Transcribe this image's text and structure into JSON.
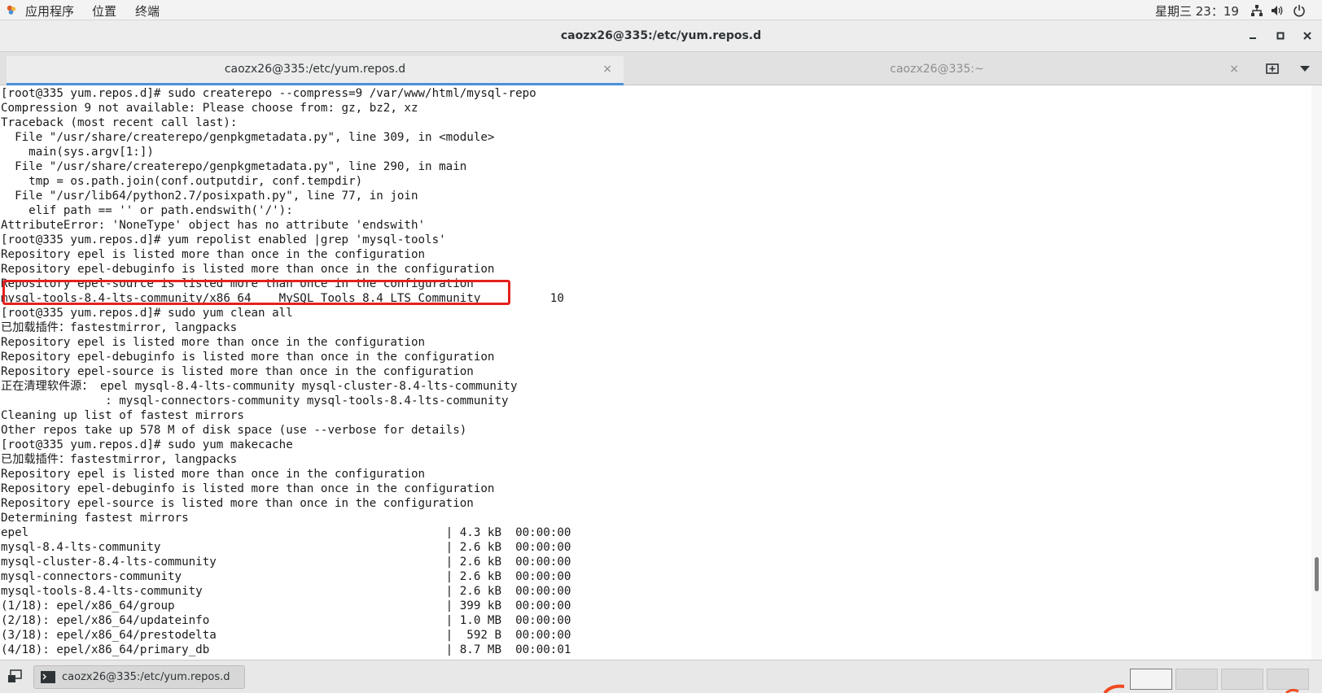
{
  "topbar": {
    "menus": [
      "应用程序",
      "位置",
      "终端"
    ],
    "clock": "星期三 23：19"
  },
  "window": {
    "title": "caozx26@335:/etc/yum.repos.d"
  },
  "tabs": [
    {
      "label": "caozx26@335:/etc/yum.repos.d",
      "active": true
    },
    {
      "label": "caozx26@335:~",
      "active": false
    }
  ],
  "terminal": {
    "lines": [
      "[root@335 yum.repos.d]# sudo createrepo --compress=9 /var/www/html/mysql-repo",
      "Compression 9 not available: Please choose from: gz, bz2, xz",
      "Traceback (most recent call last):",
      "  File \"/usr/share/createrepo/genpkgmetadata.py\", line 309, in <module>",
      "    main(sys.argv[1:])",
      "  File \"/usr/share/createrepo/genpkgmetadata.py\", line 290, in main",
      "    tmp = os.path.join(conf.outputdir, conf.tempdir)",
      "  File \"/usr/lib64/python2.7/posixpath.py\", line 77, in join",
      "    elif path == '' or path.endswith('/'):",
      "AttributeError: 'NoneType' object has no attribute 'endswith'",
      "[root@335 yum.repos.d]# yum repolist enabled |grep 'mysql-tools'",
      "Repository epel is listed more than once in the configuration",
      "Repository epel-debuginfo is listed more than once in the configuration",
      "Repository epel-source is listed more than once in the configuration",
      "mysql-tools-8.4-lts-community/x86_64    MySQL Tools 8.4 LTS Community          10",
      "[root@335 yum.repos.d]# sudo yum clean all",
      "已加载插件：fastestmirror, langpacks",
      "Repository epel is listed more than once in the configuration",
      "Repository epel-debuginfo is listed more than once in the configuration",
      "Repository epel-source is listed more than once in the configuration",
      "正在清理软件源： epel mysql-8.4-lts-community mysql-cluster-8.4-lts-community",
      "               : mysql-connectors-community mysql-tools-8.4-lts-community",
      "Cleaning up list of fastest mirrors",
      "Other repos take up 578 M of disk space (use --verbose for details)",
      "[root@335 yum.repos.d]# sudo yum makecache",
      "已加载插件：fastestmirror, langpacks",
      "Repository epel is listed more than once in the configuration",
      "Repository epel-debuginfo is listed more than once in the configuration",
      "Repository epel-source is listed more than once in the configuration",
      "Determining fastest mirrors",
      "epel                                                            | 4.3 kB  00:00:00",
      "mysql-8.4-lts-community                                         | 2.6 kB  00:00:00",
      "mysql-cluster-8.4-lts-community                                 | 2.6 kB  00:00:00",
      "mysql-connectors-community                                      | 2.6 kB  00:00:00",
      "mysql-tools-8.4-lts-community                                   | 2.6 kB  00:00:00",
      "(1/18): epel/x86_64/group                                       | 399 kB  00:00:00",
      "(2/18): epel/x86_64/updateinfo                                  | 1.0 MB  00:00:00",
      "(3/18): epel/x86_64/prestodelta                                 |  592 B  00:00:00",
      "(4/18): epel/x86_64/primary_db                                  | 8.7 MB  00:00:01"
    ]
  },
  "taskbar": {
    "item_label": "caozx26@335:/etc/yum.repos.d"
  },
  "colors": {
    "highlight": "#e4211e",
    "tab_accent": "#4a90d9"
  }
}
